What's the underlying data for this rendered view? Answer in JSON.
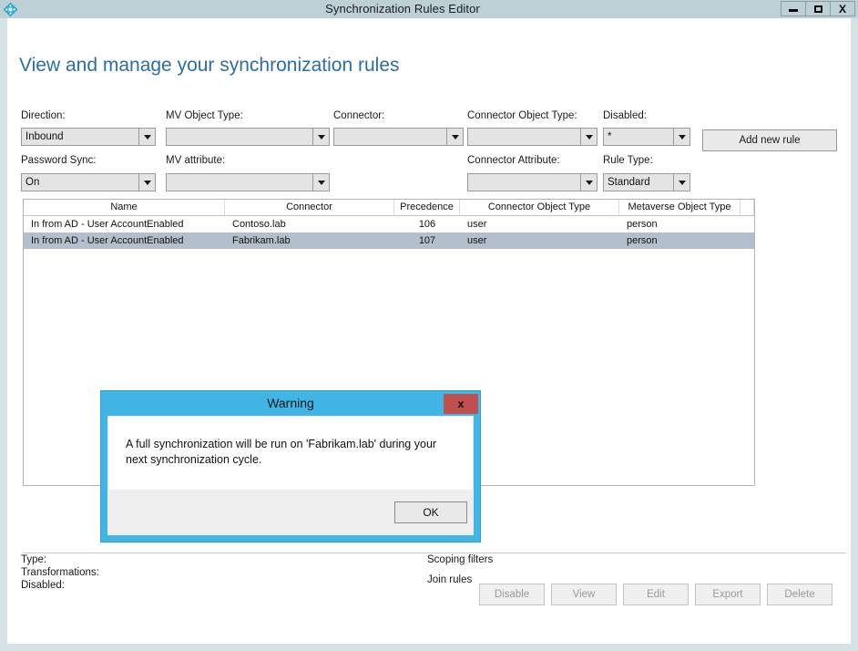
{
  "window": {
    "title": "Synchronization Rules Editor",
    "icon": "sync-diamond-icon",
    "minimize_label": "–",
    "maximize_label": "□",
    "close_label": "X"
  },
  "page": {
    "title": "View and manage your synchronization rules"
  },
  "filters": [
    {
      "label": "Direction:",
      "value": "Inbound",
      "name": "direction"
    },
    {
      "label": "MV Object Type:",
      "value": "",
      "name": "mv-object-type"
    },
    {
      "label": "Connector:",
      "value": "",
      "name": "connector"
    },
    {
      "label": "Connector Object Type:",
      "value": "",
      "name": "connector-object-type"
    },
    {
      "label": "Disabled:",
      "value": "*",
      "name": "disabled"
    },
    {
      "label": "Password Sync:",
      "value": "On",
      "name": "password-sync"
    },
    {
      "label": "MV attribute:",
      "value": "",
      "name": "mv-attribute"
    },
    {
      "label": "Connector Attribute:",
      "value": "",
      "name": "connector-attribute"
    },
    {
      "label": "Rule Type:",
      "value": "Standard",
      "name": "rule-type"
    }
  ],
  "toolbar": {
    "add_new_rule_label": "Add new rule"
  },
  "grid": {
    "columns": [
      "Name",
      "Connector",
      "Precedence",
      "Connector Object Type",
      "Metaverse Object Type"
    ],
    "rows": [
      {
        "name": "In from AD - User AccountEnabled",
        "connector": "Contoso.lab",
        "precedence": "106",
        "connector_object_type": "user",
        "metaverse_object_type": "person",
        "selected": false
      },
      {
        "name": "In from AD - User AccountEnabled",
        "connector": "Fabrikam.lab",
        "precedence": "107",
        "connector_object_type": "user",
        "metaverse_object_type": "person",
        "selected": true
      }
    ]
  },
  "details": {
    "type_label": "Type:",
    "transformations_label": "Transformations:",
    "disabled_label": "Disabled:",
    "scoping_filters_label": "Scoping filters",
    "join_rules_label": "Join rules"
  },
  "actions": [
    {
      "label": "Disable",
      "name": "disable"
    },
    {
      "label": "View",
      "name": "view"
    },
    {
      "label": "Edit",
      "name": "edit"
    },
    {
      "label": "Export",
      "name": "export"
    },
    {
      "label": "Delete",
      "name": "delete"
    }
  ],
  "dialog": {
    "title": "Warning",
    "close_label": "x",
    "message": "A full synchronization will be run on 'Fabrikam.lab' during your next synchronization cycle.",
    "ok_label": "OK"
  },
  "colors": {
    "titlebar": "#bdd0d6",
    "window_border": "#d6e2e6",
    "page_title": "#2a6ea6",
    "dialog_accent": "#41b6e6",
    "dialog_close": "#c0504d",
    "row_selected": "#b3bfcc"
  }
}
